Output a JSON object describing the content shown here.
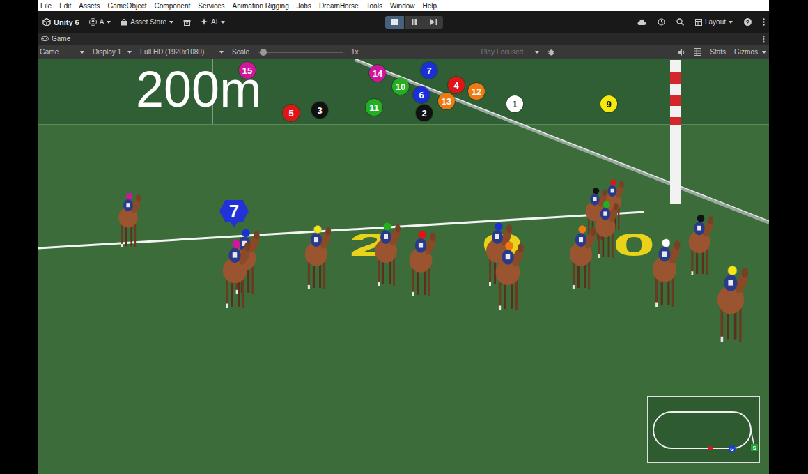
{
  "menu": [
    "File",
    "Edit",
    "Assets",
    "GameObject",
    "Component",
    "Services",
    "Animation Rigging",
    "Jobs",
    "DreamHorse",
    "Tools",
    "Window",
    "Help"
  ],
  "toolbar": {
    "app": "Unity 6",
    "account": "A",
    "asset_store": "Asset Store",
    "ai": "AI",
    "layout": "Layout",
    "help": "?",
    "play_buttons": [
      {
        "kind": "stop",
        "active": true
      },
      {
        "kind": "pause",
        "active": false
      },
      {
        "kind": "step",
        "active": false
      }
    ]
  },
  "tab": {
    "label": "Game"
  },
  "game_toolbar": {
    "view": "Game",
    "display": "Display 1",
    "resolution": "Full HD (1920x1080)",
    "scale_label": "Scale",
    "scale_level": 0.03,
    "scale_value": "1x",
    "play_mode": "Play Focused",
    "stats": "Stats",
    "gizmos": "Gizmos"
  },
  "hud": {
    "distance": "200m",
    "markers": [
      {
        "number": "15",
        "color": "#d0169c"
      },
      {
        "number": "5",
        "color": "#e01515"
      },
      {
        "number": "3",
        "color": "#111111"
      },
      {
        "number": "11",
        "color": "#22b022"
      },
      {
        "number": "14",
        "color": "#d0169c"
      },
      {
        "number": "10",
        "color": "#22b022"
      },
      {
        "number": "7",
        "color": "#1a2fd8"
      },
      {
        "number": "6",
        "color": "#1a2fd8"
      },
      {
        "number": "2",
        "color": "#111111"
      },
      {
        "number": "4",
        "color": "#e01515"
      },
      {
        "number": "13",
        "color": "#f07a10"
      },
      {
        "number": "12",
        "color": "#f07a10"
      },
      {
        "number": "1",
        "color": "#ffffff"
      },
      {
        "number": "9",
        "color": "#f4e810"
      }
    ]
  },
  "scene": {
    "ground_marking": "200",
    "focus_marker": "7",
    "horses": [
      {
        "color": "#d0169c"
      },
      {
        "color": "#1a2fd8"
      },
      {
        "color": "#d0169c"
      },
      {
        "color": "#f4e810"
      },
      {
        "color": "#22b022"
      },
      {
        "color": "#e01515"
      },
      {
        "color": "#1a2fd8"
      },
      {
        "color": "#f07a10"
      },
      {
        "color": "#f07a10"
      },
      {
        "color": "#111111"
      },
      {
        "color": "#e01515"
      },
      {
        "color": "#22b022"
      },
      {
        "color": "#ffffff"
      },
      {
        "color": "#111111"
      },
      {
        "color": "#f4e810"
      }
    ]
  },
  "minimap": {
    "start": "S",
    "goal": "G"
  }
}
